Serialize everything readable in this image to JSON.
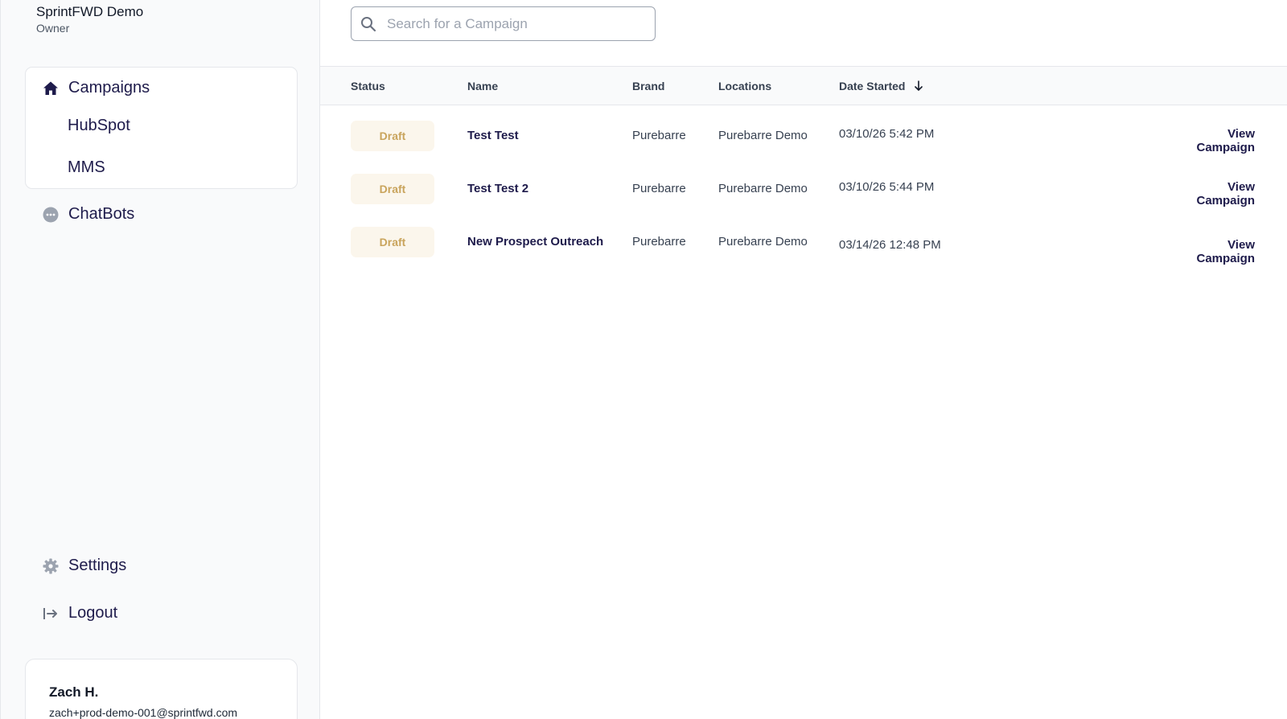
{
  "org": {
    "name": "SprintFWD Demo",
    "role": "Owner"
  },
  "nav": {
    "campaigns": {
      "label": "Campaigns",
      "icon": "home-icon"
    },
    "hubspot": {
      "label": "HubSpot"
    },
    "mms": {
      "label": "MMS"
    },
    "chatbots": {
      "label": "ChatBots",
      "icon": "chat-bubble-icon"
    },
    "settings": {
      "label": "Settings",
      "icon": "gear-icon"
    },
    "logout": {
      "label": "Logout",
      "icon": "logout-icon"
    }
  },
  "user": {
    "name": "Zach H.",
    "email": "zach+prod-demo-001@sprintfwd.com"
  },
  "search": {
    "placeholder": "Search for a Campaign",
    "value": ""
  },
  "table": {
    "columns": {
      "status": "Status",
      "name": "Name",
      "brand": "Brand",
      "locations": "Locations",
      "date_started": "Date Started"
    },
    "sort": {
      "column": "date_started",
      "direction": "descending",
      "icon": "arrow-down-icon"
    },
    "rows": [
      {
        "status": "Draft",
        "name": "Test Test",
        "brand": "Purebarre",
        "locations": "Purebarre Demo",
        "date_started": "03/10/26 5:42 PM",
        "action": "View Campaign"
      },
      {
        "status": "Draft",
        "name": "Test Test 2",
        "brand": "Purebarre",
        "locations": "Purebarre Demo",
        "date_started": "03/10/26 5:44 PM",
        "action": "View Campaign"
      },
      {
        "status": "Draft",
        "name": "New Prospect Outreach",
        "brand": "Purebarre",
        "locations": "Purebarre Demo",
        "date_started": "03/14/26 12:48 PM",
        "action": "View Campaign"
      }
    ]
  },
  "colors": {
    "accent": "#1e1b4b",
    "draft_badge_bg": "#fbf6ec",
    "draft_badge_text": "#c9a45c",
    "muted_icon": "#9ca3af"
  }
}
